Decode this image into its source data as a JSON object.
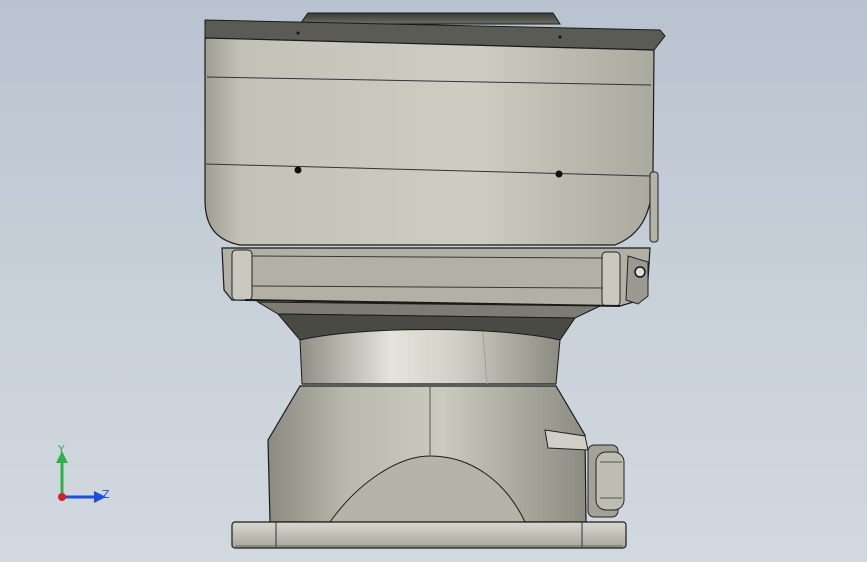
{
  "viewport": {
    "background_top": "#b9c3cf",
    "background_bottom": "#d2d8df"
  },
  "model": {
    "body_color": "#c4c4ba",
    "edge_color": "#222222"
  },
  "triad": {
    "y_label": "Y",
    "z_label": "Z",
    "y_color": "#2db34a",
    "z_color": "#1f4fd6",
    "x_color": "#d42020"
  }
}
